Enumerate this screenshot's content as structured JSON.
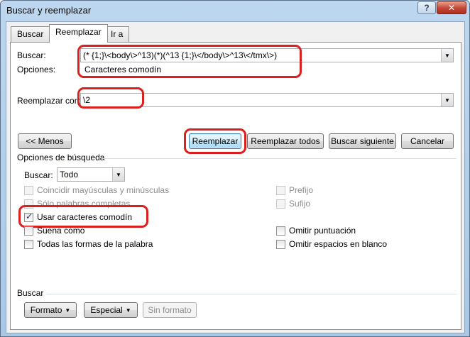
{
  "window": {
    "title": "Buscar y reemplazar",
    "help_button": "?",
    "close_button": "x"
  },
  "tabs": [
    {
      "label": "Buscar",
      "active": false
    },
    {
      "label": "Reemplazar",
      "active": true
    },
    {
      "label": "Ir a",
      "active": false
    }
  ],
  "find": {
    "label": "Buscar:",
    "value": "(* {1;}\\<body\\>^13)(*)(^13 {1;}\\</body\\>^13\\</tmx\\>)",
    "options_label": "Opciones:",
    "options_value": "Caracteres comodín"
  },
  "replace": {
    "label": "Reemplazar con:",
    "value": "\\2"
  },
  "buttons": {
    "less": "<< Menos",
    "replace": "Reemplazar",
    "replace_all": "Reemplazar todos",
    "find_next": "Buscar siguiente",
    "cancel": "Cancelar"
  },
  "search_options": {
    "title": "Opciones de búsqueda",
    "direction_label": "Buscar:",
    "direction_value": "Todo",
    "left": [
      {
        "label": "Coincidir mayúsculas y minúsculas",
        "checked": false,
        "enabled": false
      },
      {
        "label": "Sólo palabras completas",
        "checked": false,
        "enabled": false
      },
      {
        "label": "Usar caracteres comodín",
        "checked": true,
        "enabled": true
      },
      {
        "label": "Suena como",
        "checked": false,
        "enabled": true
      },
      {
        "label": "Todas las formas de la palabra",
        "checked": false,
        "enabled": true
      }
    ],
    "right": [
      {
        "label": "Prefijo",
        "checked": false,
        "enabled": false
      },
      {
        "label": "Sufijo",
        "checked": false,
        "enabled": false
      },
      {
        "label": "Omitir puntuación",
        "checked": false,
        "enabled": true
      },
      {
        "label": "Omitir espacios en blanco",
        "checked": false,
        "enabled": true
      }
    ]
  },
  "replace_section": {
    "title": "Buscar",
    "format_button": "Formato",
    "special_button": "Especial",
    "no_format_button": "Sin formato"
  },
  "colors": {
    "highlight": "#d9201e",
    "default_button_border": "#3c7fb1",
    "close_button": "#c24431"
  },
  "icons": {
    "dropdown": "chevron-down-icon",
    "checkmark": "checkmark-icon",
    "dropdown_arrow": "triangle-down-icon"
  }
}
